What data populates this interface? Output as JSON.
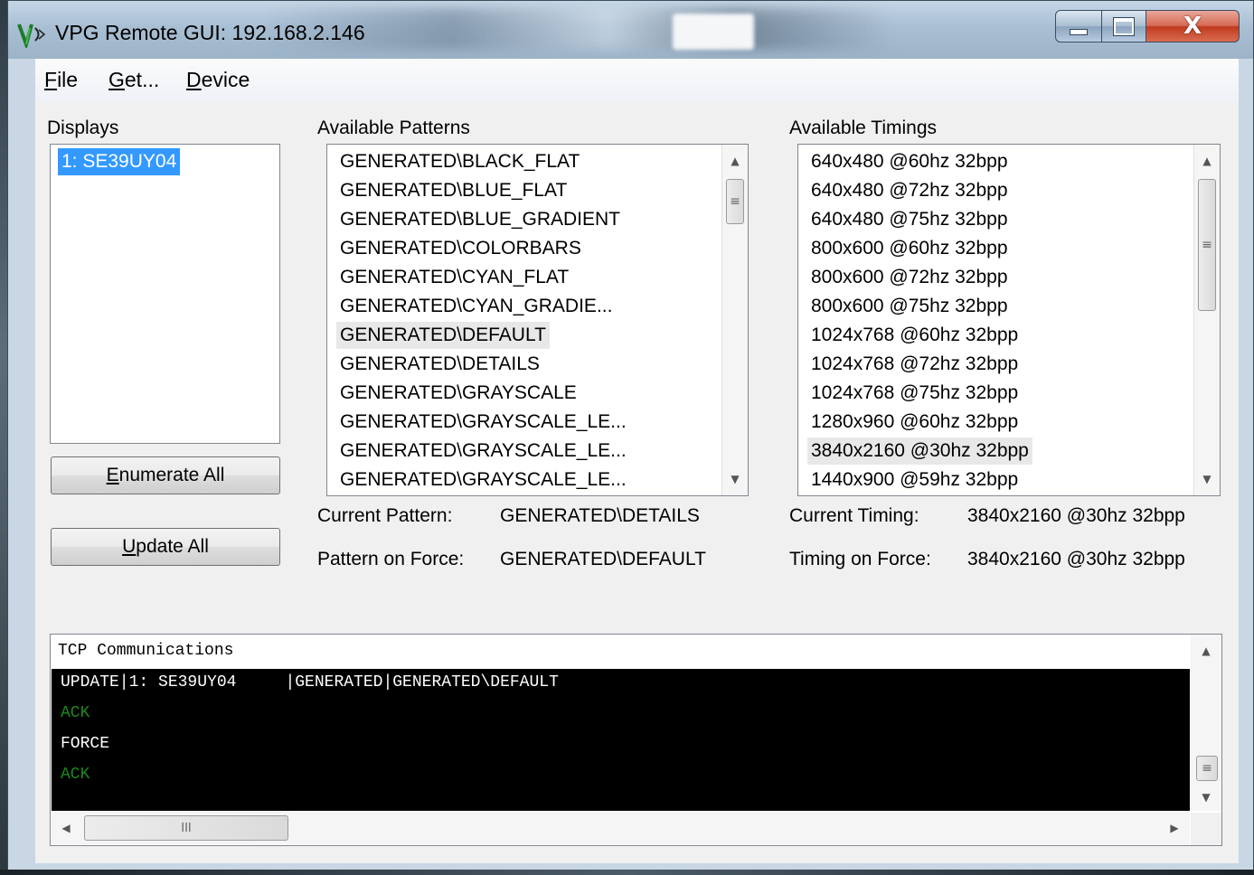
{
  "window": {
    "title": "VPG Remote GUI: 192.168.2.146",
    "close_glyph": "X"
  },
  "menu": {
    "file": {
      "accel": "F",
      "rest": "ile"
    },
    "get": {
      "accel": "G",
      "rest": "et..."
    },
    "device": {
      "accel": "D",
      "rest": "evice"
    }
  },
  "displays": {
    "label": "Displays",
    "items": [
      "1: SE39UY04"
    ],
    "selected": "1: SE39UY04"
  },
  "buttons": {
    "enumerate_all": {
      "accel": "E",
      "rest": "numerate All"
    },
    "update_all": {
      "accel": "U",
      "rest": "pdate All"
    }
  },
  "patterns": {
    "label": "Available Patterns",
    "items": [
      "GENERATED\\BLACK_FLAT",
      "GENERATED\\BLUE_FLAT",
      "GENERATED\\BLUE_GRADIENT",
      "GENERATED\\COLORBARS",
      "GENERATED\\CYAN_FLAT",
      "GENERATED\\CYAN_GRADIE...",
      "GENERATED\\DEFAULT",
      "GENERATED\\DETAILS",
      "GENERATED\\GRAYSCALE",
      "GENERATED\\GRAYSCALE_LE...",
      "GENERATED\\GRAYSCALE_LE...",
      "GENERATED\\GRAYSCALE_LE..."
    ],
    "highlighted": "GENERATED\\DEFAULT",
    "current_label": "Current Pattern:",
    "current_value": "GENERATED\\DETAILS",
    "force_label": "Pattern on Force:",
    "force_value": "GENERATED\\DEFAULT"
  },
  "timings": {
    "label": "Available Timings",
    "items": [
      "640x480 @60hz 32bpp",
      "640x480 @72hz 32bpp",
      "640x480 @75hz 32bpp",
      "800x600 @60hz 32bpp",
      "800x600 @72hz 32bpp",
      "800x600 @75hz 32bpp",
      "1024x768 @60hz 32bpp",
      "1024x768 @72hz 32bpp",
      "1024x768 @75hz 32bpp",
      "1280x960 @60hz 32bpp",
      "3840x2160 @30hz 32bpp",
      "1440x900 @59hz 32bpp"
    ],
    "highlighted": "3840x2160 @30hz 32bpp",
    "current_label": "Current Timing:",
    "current_value": "3840x2160 @30hz 32bpp",
    "force_label": "Timing on Force:",
    "force_value": "3840x2160 @30hz 32bpp"
  },
  "tcp": {
    "header": "TCP Communications",
    "lines": [
      {
        "text": "UPDATE|1: SE39UY04     |GENERATED|GENERATED\\DEFAULT",
        "color": "#ffffff"
      },
      {
        "text": "ACK",
        "color": "#1a8a1a"
      },
      {
        "text": "FORCE",
        "color": "#ffffff"
      },
      {
        "text": "ACK",
        "color": "#1a8a1a"
      }
    ]
  },
  "icons": {
    "app": "vpg-logo-icon",
    "scroll_up": "▲",
    "scroll_down": "▼",
    "scroll_left": "◀",
    "scroll_right": "▶",
    "grip": "≡",
    "hgrip": "III"
  },
  "colors": {
    "selection": "#3399ff",
    "console_bg": "#000000",
    "console_green": "#1a8a1a",
    "close_red": "#c03a20"
  }
}
